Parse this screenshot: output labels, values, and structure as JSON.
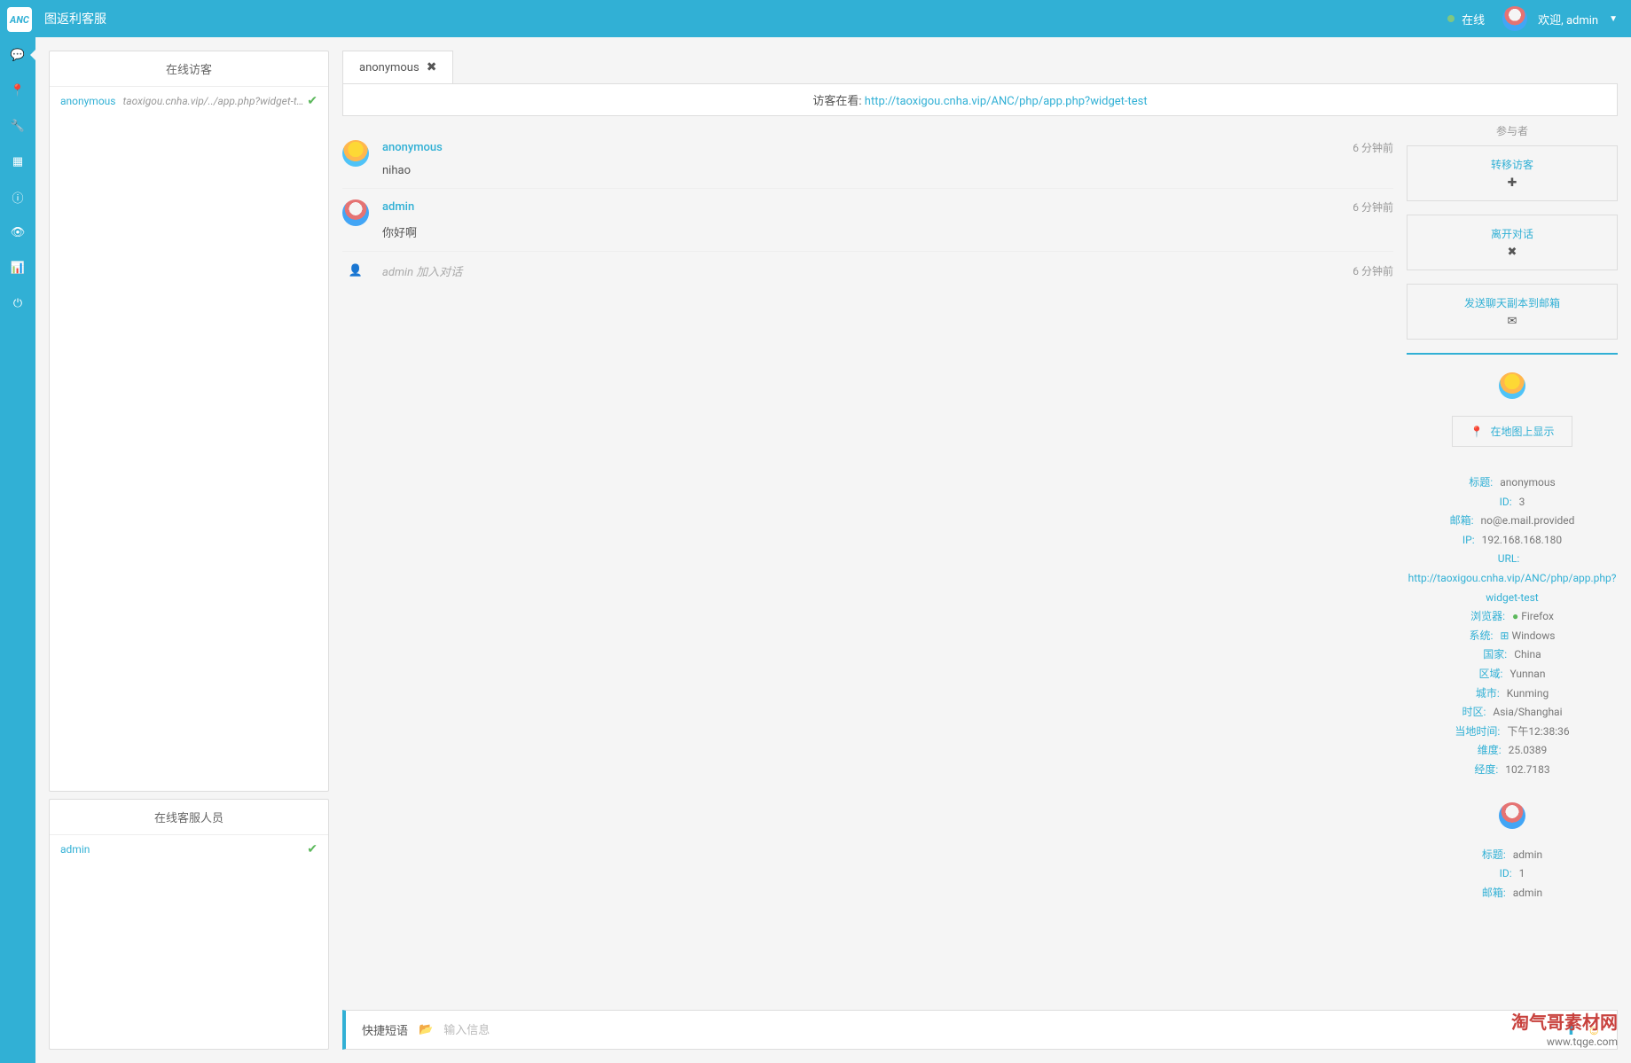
{
  "topbar": {
    "logo": "ANC",
    "title": "图返利客服",
    "status": "在线",
    "welcome": "欢迎, admin"
  },
  "sidebar": {
    "items": [
      "chat-icon",
      "pin-icon",
      "wrench-icon",
      "grid-icon",
      "info-icon",
      "eye-icon",
      "bars-icon",
      "power-icon"
    ]
  },
  "leftPanel": {
    "visitorHeader": "在线访客",
    "operatorHeader": "在线客服人员",
    "visitor": {
      "name": "anonymous",
      "url": "taoxigou.cnha.vip/../app.php?widget-test"
    },
    "operator": {
      "name": "admin"
    }
  },
  "tabs": {
    "active": "anonymous"
  },
  "visitorBar": {
    "label": "访客在看:",
    "url": "http://taoxigou.cnha.vip/ANC/php/app.php?widget-test"
  },
  "messages": {
    "msg1": {
      "name": "anonymous",
      "time": "6 分钟前",
      "text": "nihao"
    },
    "msg2": {
      "name": "admin",
      "time": "6 分钟前",
      "text": "你好啊"
    },
    "system": {
      "text": "admin 加入对话",
      "time": "6 分钟前"
    }
  },
  "rightPanel": {
    "participants": "参与者",
    "transfer": "转移访客",
    "leave": "离开对话",
    "sendMail": "发送聊天副本到邮箱",
    "mapBtn": "在地图上显示",
    "info": {
      "titleLabel": "标题:",
      "title": "anonymous",
      "idLabel": "ID:",
      "id": "3",
      "emailLabel": "邮箱:",
      "email": "no@e.mail.provided",
      "ipLabel": "IP:",
      "ip": "192.168.168.180",
      "urlLabel": "URL:",
      "url": "http://taoxigou.cnha.vip/ANC/php/app.php?widget-test",
      "browserLabel": "浏览器:",
      "browser": "Firefox",
      "systemLabel": "系统:",
      "system": "Windows",
      "countryLabel": "国家:",
      "country": "China",
      "regionLabel": "区域:",
      "region": "Yunnan",
      "cityLabel": "城市:",
      "city": "Kunming",
      "tzLabel": "时区:",
      "tz": "Asia/Shanghai",
      "localTimeLabel": "当地时间:",
      "localTime": "下午12:38:36",
      "latLabel": "维度:",
      "lat": "25.0389",
      "lngLabel": "经度:",
      "lng": "102.7183"
    },
    "info2": {
      "titleLabel": "标题:",
      "title": "admin",
      "idLabel": "ID:",
      "id": "1",
      "emailLabel": "邮箱:",
      "email": "admin"
    }
  },
  "inputBar": {
    "label": "快捷短语",
    "placeholder": "输入信息"
  },
  "watermark": {
    "title": "淘气哥素材网",
    "url": "www.tqge.com"
  }
}
